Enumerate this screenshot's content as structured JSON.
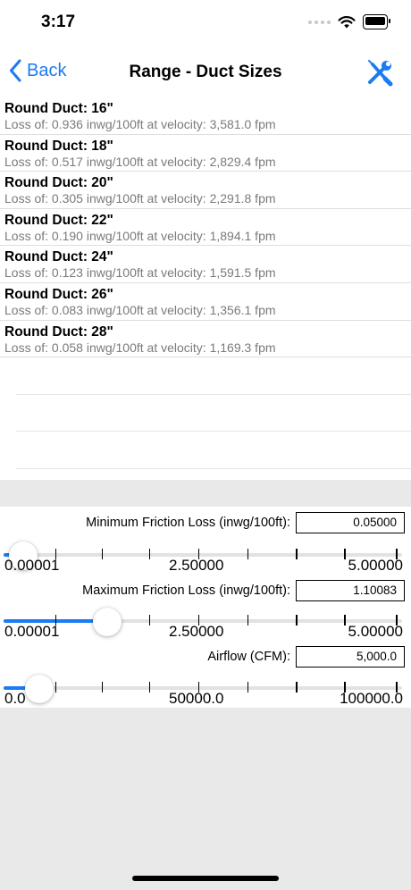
{
  "status_bar": {
    "time": "3:17"
  },
  "nav": {
    "back_label": "Back",
    "title": "Range - Duct Sizes",
    "tools_icon": "wrench-screwdriver-icon"
  },
  "results": [
    {
      "title": "Round Duct: 16\"",
      "detail": "Loss of: 0.936 inwg/100ft at velocity: 3,581.0 fpm"
    },
    {
      "title": "Round Duct: 18\"",
      "detail": "Loss of: 0.517 inwg/100ft at velocity: 2,829.4 fpm"
    },
    {
      "title": "Round Duct: 20\"",
      "detail": "Loss of: 0.305 inwg/100ft at velocity: 2,291.8 fpm"
    },
    {
      "title": "Round Duct: 22\"",
      "detail": "Loss of: 0.190 inwg/100ft at velocity: 1,894.1 fpm"
    },
    {
      "title": "Round Duct: 24\"",
      "detail": "Loss of: 0.123 inwg/100ft at velocity: 1,591.5 fpm"
    },
    {
      "title": "Round Duct: 26\"",
      "detail": "Loss of: 0.083 inwg/100ft at velocity: 1,356.1 fpm"
    },
    {
      "title": "Round Duct: 28\"",
      "detail": "Loss of: 0.058 inwg/100ft at velocity: 1,169.3 fpm"
    }
  ],
  "controls": {
    "min_friction": {
      "label": "Minimum Friction Loss (inwg/100ft):",
      "value": "0.05000",
      "scale": [
        "0.00001",
        "2.50000",
        "5.00000"
      ],
      "slider_fraction": 0.01
    },
    "max_friction": {
      "label": "Maximum Friction Loss (inwg/100ft):",
      "value": "1.10083",
      "scale": [
        "0.00001",
        "2.50000",
        "5.00000"
      ],
      "slider_fraction": 0.22
    },
    "airflow": {
      "label": "Airflow (CFM):",
      "value": "5,000.0",
      "scale": [
        "0.0",
        "50000.0",
        "100000.0"
      ],
      "slider_fraction": 0.05
    }
  },
  "colors": {
    "accent": "#1b7bf4",
    "track": "#e2e2e4",
    "detail_text": "#7a7a7a"
  }
}
